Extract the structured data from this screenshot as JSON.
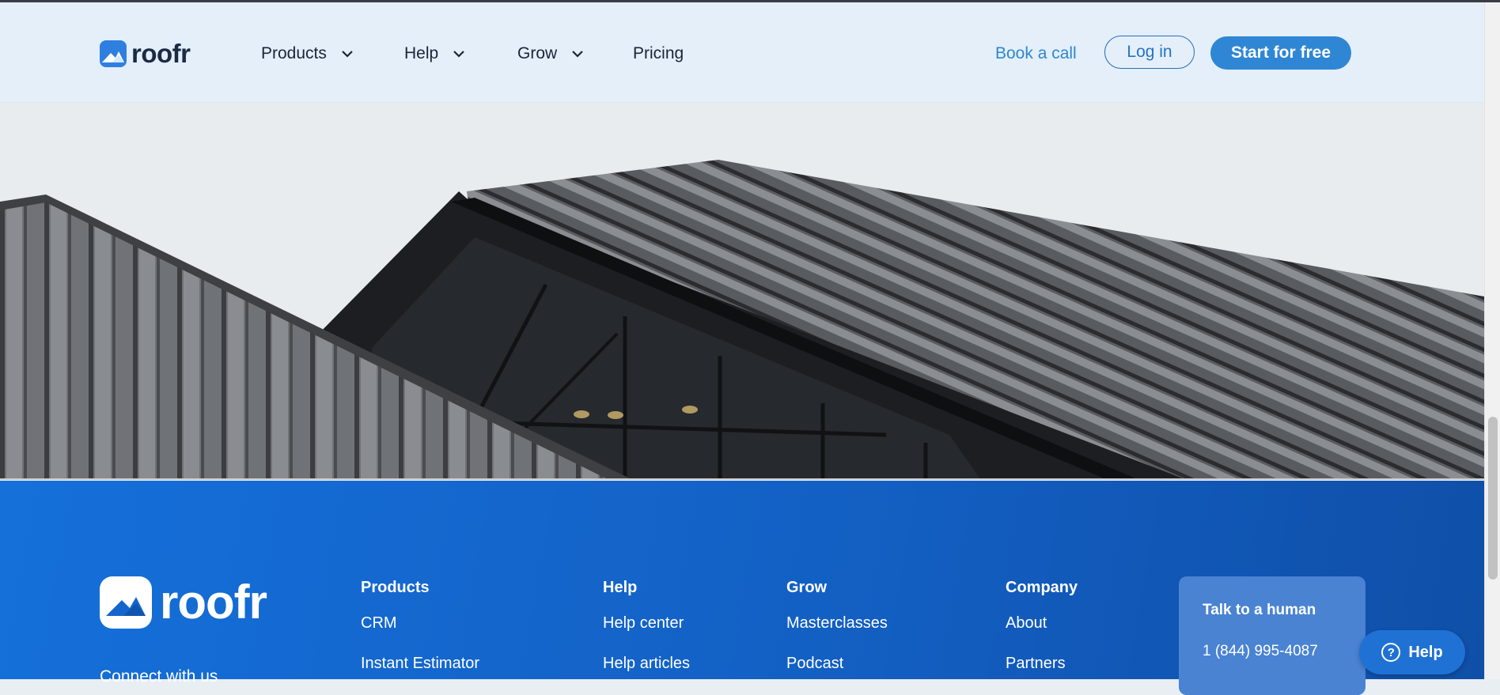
{
  "header": {
    "brand": "roofr",
    "nav": [
      {
        "label": "Products"
      },
      {
        "label": "Help"
      },
      {
        "label": "Grow"
      },
      {
        "label": "Pricing"
      }
    ],
    "book_call": "Book a call",
    "login": "Log in",
    "start": "Start for free"
  },
  "footer": {
    "brand": "roofr",
    "connect": "Connect with us",
    "columns": [
      {
        "title": "Products",
        "links": [
          "CRM",
          "Instant Estimator"
        ]
      },
      {
        "title": "Help",
        "links": [
          "Help center",
          "Help articles"
        ]
      },
      {
        "title": "Grow",
        "links": [
          "Masterclasses",
          "Podcast"
        ]
      },
      {
        "title": "Company",
        "links": [
          "About",
          "Partners"
        ]
      }
    ],
    "talk": {
      "title": "Talk to a human",
      "phone": "1 (844) 995-4087"
    }
  },
  "help_fab": {
    "label": "Help",
    "icon": "?"
  },
  "colors": {
    "brand_blue": "#2f86d4",
    "header_bg": "#e4effa",
    "footer_blue": "#1467d0",
    "text_dark": "#1b2438"
  }
}
